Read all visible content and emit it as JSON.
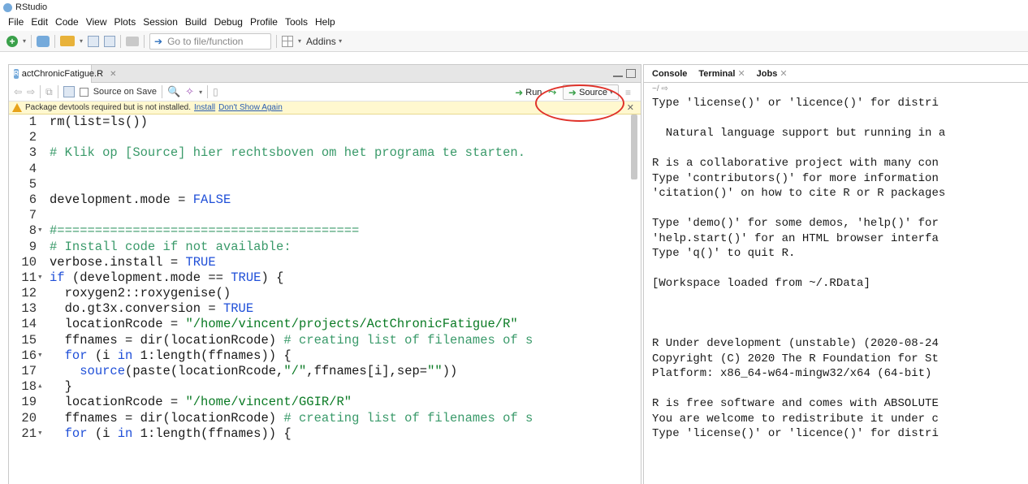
{
  "app": {
    "title": "RStudio"
  },
  "menu": [
    "File",
    "Edit",
    "Code",
    "View",
    "Plots",
    "Session",
    "Build",
    "Debug",
    "Profile",
    "Tools",
    "Help"
  ],
  "toolbar": {
    "goto_placeholder": "Go to file/function",
    "addins_label": "Addins"
  },
  "editor": {
    "tab_label": "actChronicFatigue.R",
    "source_on_save_label": "Source on Save",
    "run_label": "Run",
    "source_label": "Source",
    "warning": {
      "message": "Package devtools required but is not installed.",
      "install_link": "Install",
      "dont_show_link": "Don't Show Again"
    },
    "lines": [
      {
        "n": "1",
        "fold": "",
        "html": "rm(list=ls())"
      },
      {
        "n": "2",
        "fold": "",
        "html": ""
      },
      {
        "n": "3",
        "fold": "",
        "html": "<span class='cm'># Klik op [Source] hier rechtsboven om het programa te starten.</span>"
      },
      {
        "n": "4",
        "fold": "",
        "html": ""
      },
      {
        "n": "5",
        "fold": "",
        "html": ""
      },
      {
        "n": "6",
        "fold": "",
        "html": "development.mode = <span class='kw'>FALSE</span>"
      },
      {
        "n": "7",
        "fold": "",
        "html": ""
      },
      {
        "n": "8",
        "fold": "▾",
        "html": "<span class='cm'>#========================================</span>"
      },
      {
        "n": "9",
        "fold": "",
        "html": "<span class='cm'># Install code if not available:</span>"
      },
      {
        "n": "10",
        "fold": "",
        "html": "verbose.install = <span class='kw'>TRUE</span>"
      },
      {
        "n": "11",
        "fold": "▾",
        "html": "<span class='kw'>if</span> (development.mode == <span class='kw'>TRUE</span>) {"
      },
      {
        "n": "12",
        "fold": "",
        "html": "  roxygen2::roxygenise()"
      },
      {
        "n": "13",
        "fold": "",
        "html": "  do.gt3x.conversion = <span class='kw'>TRUE</span>"
      },
      {
        "n": "14",
        "fold": "",
        "html": "  locationRcode = <span class='st'>\"/home/vincent/projects/ActChronicFatigue/R\"</span>"
      },
      {
        "n": "15",
        "fold": "",
        "html": "  ffnames = dir(locationRcode) <span class='cm'># creating list of filenames of s</span>"
      },
      {
        "n": "16",
        "fold": "▾",
        "html": "  <span class='kw'>for</span> (i <span class='kw'>in</span> 1:length(ffnames)) {"
      },
      {
        "n": "17",
        "fold": "",
        "html": "    <span class='kw'>source</span>(paste(locationRcode,<span class='st'>\"/\"</span>,ffnames[i],sep=<span class='st'>\"\"</span>))"
      },
      {
        "n": "18",
        "fold": "▴",
        "html": "  }"
      },
      {
        "n": "19",
        "fold": "",
        "html": "  locationRcode = <span class='st'>\"/home/vincent/GGIR/R\"</span>"
      },
      {
        "n": "20",
        "fold": "",
        "html": "  ffnames = dir(locationRcode) <span class='cm'># creating list of filenames of s</span>"
      },
      {
        "n": "21",
        "fold": "▾",
        "html": "  <span class='kw'>for</span> (i <span class='kw'>in</span> 1:length(ffnames)) {"
      }
    ]
  },
  "console": {
    "tabs": [
      {
        "label": "Console",
        "closable": false
      },
      {
        "label": "Terminal",
        "closable": true
      },
      {
        "label": "Jobs",
        "closable": true
      }
    ],
    "path": "~/",
    "text": "Type 'license()' or 'licence()' for distri\n\n  Natural language support but running in a\n\nR is a collaborative project with many con\nType 'contributors()' for more information\n'citation()' on how to cite R or R packages\n\nType 'demo()' for some demos, 'help()' for\n'help.start()' for an HTML browser interfa\nType 'q()' to quit R.\n\n[Workspace loaded from ~/.RData]\n\n\n\nR Under development (unstable) (2020-08-24\nCopyright (C) 2020 The R Foundation for St\nPlatform: x86_64-w64-mingw32/x64 (64-bit)\n\nR is free software and comes with ABSOLUTE\nYou are welcome to redistribute it under c\nType 'license()' or 'licence()' for distri"
  }
}
